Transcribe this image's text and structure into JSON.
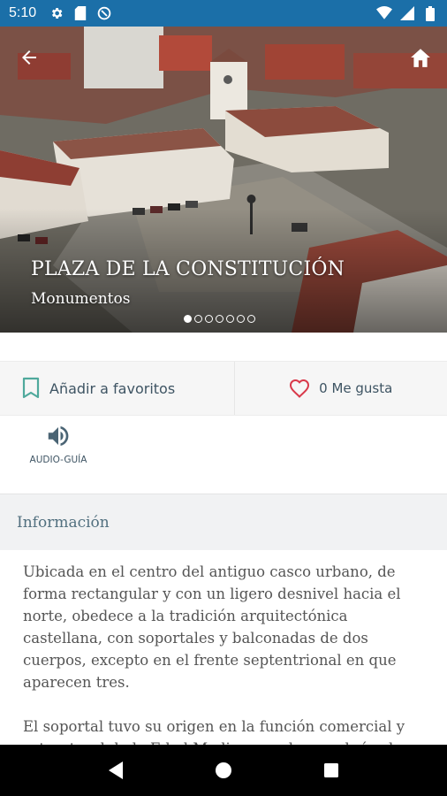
{
  "status_bar": {
    "time": "5:10",
    "left_icons": [
      "gear-icon",
      "sd-card-icon",
      "data-saver-icon"
    ],
    "right_icons": [
      "wifi-icon",
      "signal-icon",
      "battery-icon"
    ],
    "background": "#1b6fa8"
  },
  "hero": {
    "title": "PLAZA DE LA CONSTITUCIÓN",
    "subtitle": "Monumentos",
    "slides_total": 7,
    "slide_active": 1,
    "back_icon": "arrow-back-icon",
    "home_icon": "home-icon"
  },
  "actions": {
    "favorite": {
      "label": "Añadir a favoritos",
      "icon": "bookmark-icon",
      "color": "#4fa99c"
    },
    "like": {
      "label": "0 Me gusta",
      "icon": "heart-icon",
      "color": "#d9394a"
    }
  },
  "audio_guide": {
    "label": "AUDIO-GUÍA",
    "icon": "volume-icon"
  },
  "info": {
    "title": "Información",
    "paragraphs": [
      "Ubicada en el centro del antiguo casco urbano, de forma rectangular y con un ligero desnivel hacia el norte, obedece a la tradición arquitectónica castellana, con soportales y balconadas de dos cuerpos, excepto en el frente septentrional en que aparecen tres.",
      "El soportal tuvo su origen en la función comercial y estructural de la Edad Media, cuando se cubrían las plazas"
    ]
  },
  "nav_bar": {
    "buttons": [
      "back-triangle-icon",
      "home-circle-icon",
      "recents-square-icon"
    ]
  }
}
